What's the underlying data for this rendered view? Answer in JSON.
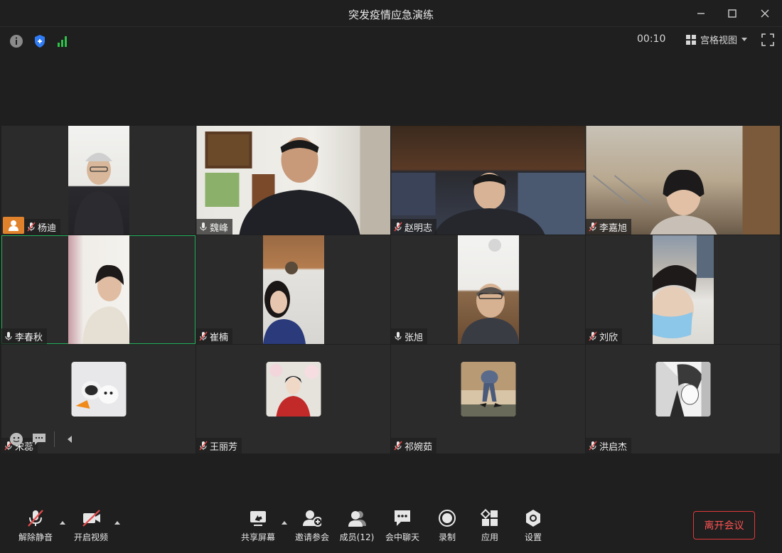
{
  "window": {
    "title": "突发疫情应急演练"
  },
  "status": {
    "timer": "00:10",
    "view_mode": "宫格视图"
  },
  "participants": [
    {
      "name": "杨迪",
      "mic": "muted",
      "host": true
    },
    {
      "name": "魏峰",
      "mic": "on"
    },
    {
      "name": "赵明志",
      "mic": "muted"
    },
    {
      "name": "李嘉旭",
      "mic": "muted"
    },
    {
      "name": "李春秋",
      "mic": "on",
      "active": true
    },
    {
      "name": "崔楠",
      "mic": "muted"
    },
    {
      "name": "张旭",
      "mic": "on"
    },
    {
      "name": "刘欣",
      "mic": "muted"
    },
    {
      "name": "宋蕊",
      "mic": "muted"
    },
    {
      "name": "王丽芳",
      "mic": "muted"
    },
    {
      "name": "祁婉茹",
      "mic": "muted"
    },
    {
      "name": "洪启杰",
      "mic": "muted"
    }
  ],
  "toolbar": {
    "unmute": "解除静音",
    "start_video": "开启视频",
    "share_screen": "共享屏幕",
    "invite": "邀请参会",
    "members": "成员(12)",
    "chat": "会中聊天",
    "record": "录制",
    "apps": "应用",
    "settings": "设置",
    "leave": "离开会议"
  },
  "colors": {
    "leave": "#e0393a",
    "active_border": "#22b35c",
    "host_badge": "#e0822c",
    "signal": "#2ec24a",
    "shield": "#2f7cf6"
  }
}
